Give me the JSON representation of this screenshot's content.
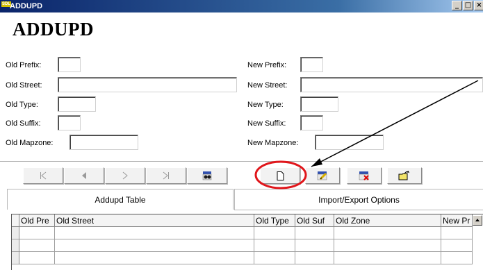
{
  "window": {
    "title": "ADDUPD",
    "app_icon_text": "SDL",
    "buttons": {
      "minimize": "_",
      "maximize": "□",
      "close": "×"
    }
  },
  "form": {
    "title": "ADDUPD",
    "old_prefix": {
      "label": "Old Prefix:",
      "value": ""
    },
    "old_street": {
      "label": "Old Street:",
      "value": ""
    },
    "old_type": {
      "label": "Old Type:",
      "value": ""
    },
    "old_suffix": {
      "label": "Old Suffix:",
      "value": ""
    },
    "old_mapzone": {
      "label": "Old Mapzone:",
      "value": ""
    },
    "new_prefix": {
      "label": "New Prefix:",
      "value": ""
    },
    "new_street": {
      "label": "New Street:",
      "value": ""
    },
    "new_type": {
      "label": "New Type:",
      "value": ""
    },
    "new_suffix": {
      "label": "New Suffix:",
      "value": ""
    },
    "new_mapzone": {
      "label": "New Mapzone:",
      "value": ""
    }
  },
  "toolbar": {
    "icons": [
      "first-record-icon",
      "previous-record-icon",
      "next-record-icon",
      "last-record-icon",
      "find-icon",
      "new-record-icon",
      "edit-record-icon",
      "delete-record-icon",
      "open-folder-icon"
    ]
  },
  "tabs": [
    {
      "label": "Addupd Table",
      "active": true
    },
    {
      "label": "Import/Export Options",
      "active": false
    }
  ],
  "table": {
    "columns": [
      "Old Pre",
      "Old Street",
      "Old Type",
      "Old Suf",
      "Old Zone",
      "New Pr"
    ],
    "rows": [
      [
        "",
        "",
        "",
        "",
        "",
        ""
      ],
      [
        "",
        "",
        "",
        "",
        "",
        ""
      ],
      [
        "",
        "",
        "",
        "",
        "",
        ""
      ]
    ]
  },
  "colors": {
    "annotation": "#e0161b",
    "titlebar": "#0a246a"
  }
}
